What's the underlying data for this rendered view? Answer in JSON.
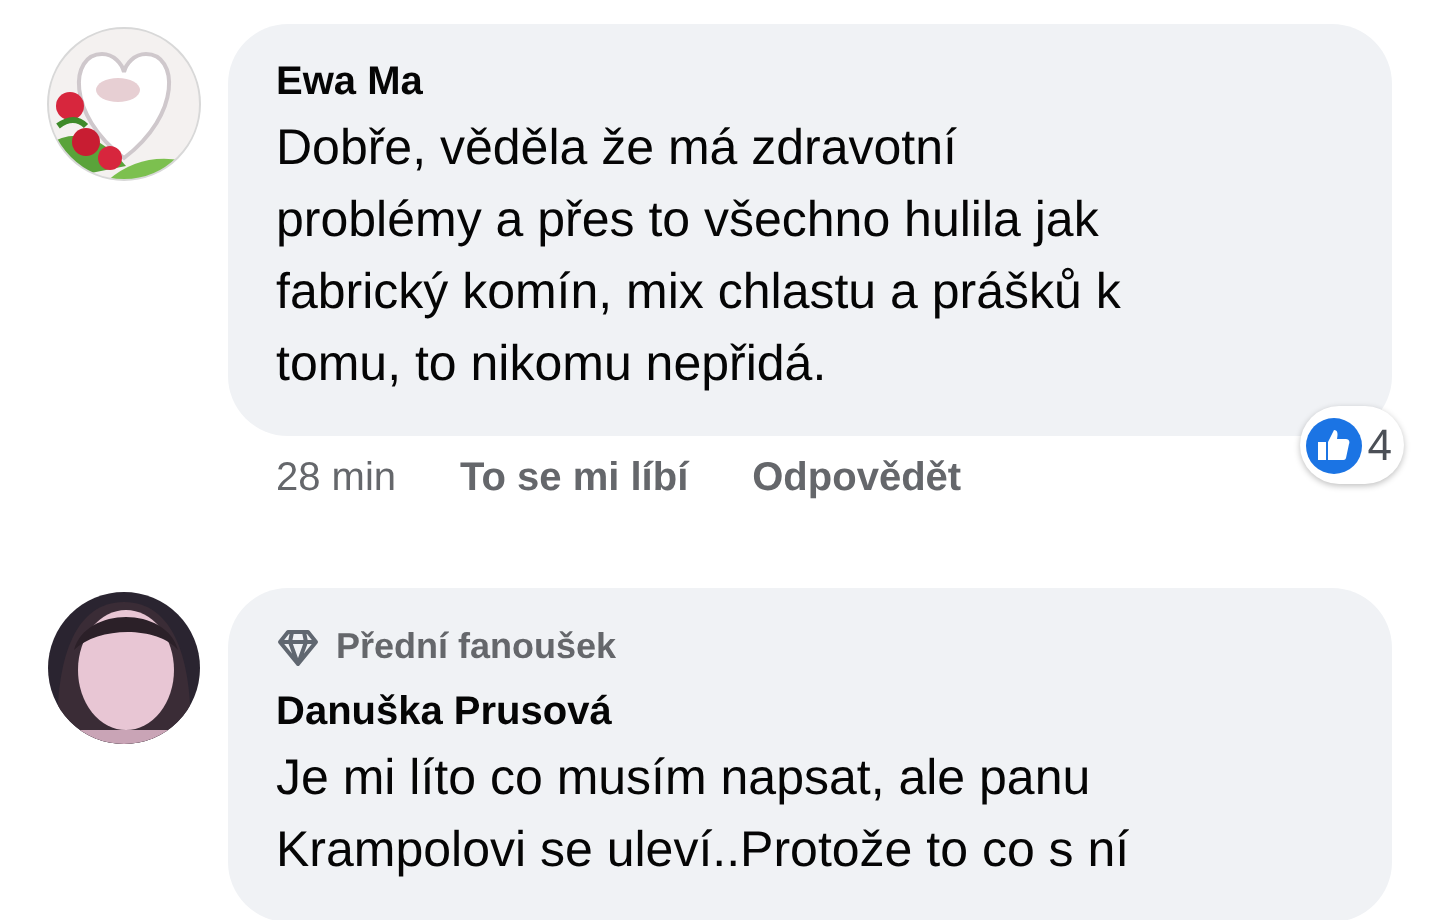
{
  "comments": [
    {
      "kind": "comment",
      "author": "Ewa Ma",
      "text": "Dobře, věděla že má zdravotní\nproblémy a přes to všechno hulila jak\nfabrický komín, mix chlastu a prášků k\ntomu, to nikomu nepřidá.",
      "time": "28 min",
      "actions": [
        "To se mi líbí",
        "Odpovědět"
      ],
      "reactions": {
        "count": "4"
      }
    },
    {
      "kind": "comment",
      "badge": "Přední fanoušek",
      "author": "Danuška Prusová",
      "text": "Je mi líto co musím napsat, ale panu\nKrampolovi se uleví..Protože to co s ní"
    }
  ]
}
